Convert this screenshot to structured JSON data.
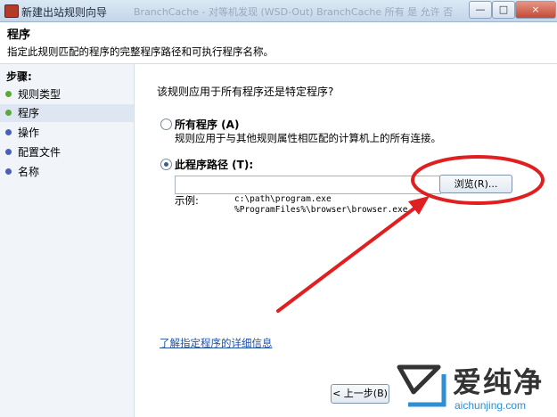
{
  "window": {
    "title": "新建出站规则向导",
    "ghost_text": "BranchCache - 对等机发现 (WSD-Out)      BranchCache      所有     是     允许     否",
    "minimize": "—",
    "maximize": "□",
    "close": "×"
  },
  "header": {
    "title": "程序",
    "description": "指定此规则匹配的程序的完整程序路径和可执行程序名称。"
  },
  "steps": {
    "title": "步骤:",
    "items": [
      {
        "label": "规则类型",
        "color": "#5aa83a",
        "active": false
      },
      {
        "label": "程序",
        "color": "#5aa83a",
        "active": true
      },
      {
        "label": "操作",
        "color": "#4a5fb8",
        "active": false
      },
      {
        "label": "配置文件",
        "color": "#4a5fb8",
        "active": false
      },
      {
        "label": "名称",
        "color": "#4a5fb8",
        "active": false
      }
    ]
  },
  "main": {
    "question": "该规则应用于所有程序还是特定程序?",
    "option_all": {
      "label": "所有程序 (A)",
      "description": "规则应用于与其他规则属性相匹配的计算机上的所有连接。",
      "selected": false
    },
    "option_path": {
      "label": "此程序路径 (T):",
      "selected": true
    },
    "path_value": "",
    "browse_label": "浏览(R)...",
    "example_label": "示例:",
    "example_lines": [
      "c:\\path\\program.exe",
      "%ProgramFiles%\\browser\\browser.exe"
    ],
    "learn_more": "了解指定程序的详细信息",
    "back_label": "< 上一步(B)"
  },
  "watermark": {
    "text": "爱纯净",
    "url": "aichunjing.com"
  },
  "colors": {
    "annotation_red": "#e02020",
    "link_blue": "#1f4fa5"
  }
}
